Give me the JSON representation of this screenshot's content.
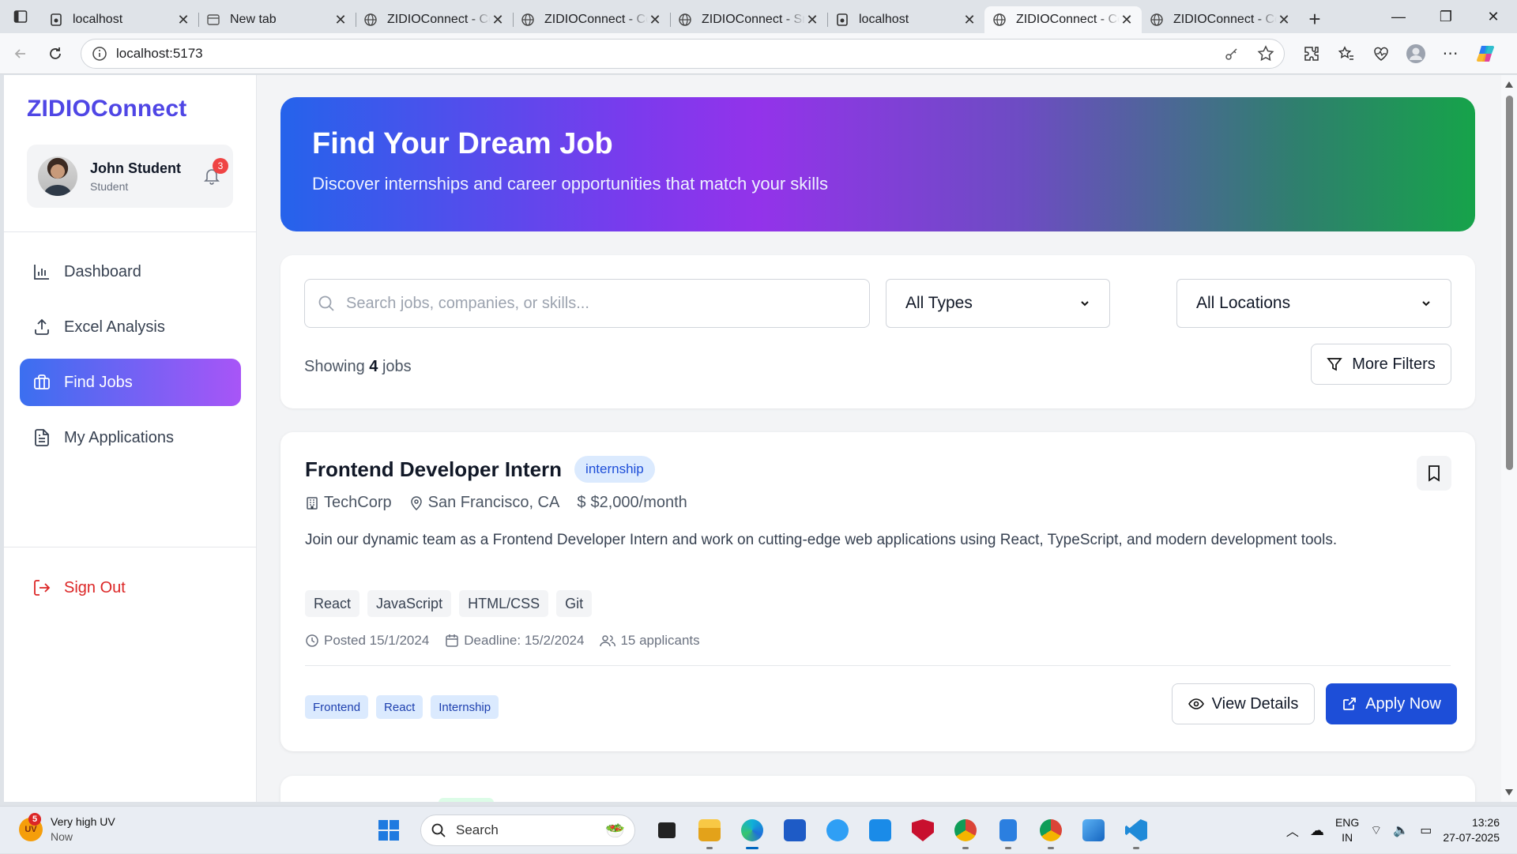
{
  "browser": {
    "tabs": [
      {
        "title": "localhost",
        "favicon": "page-icon",
        "active": false
      },
      {
        "title": "New tab",
        "favicon": "newtab-icon",
        "active": false
      },
      {
        "title": "ZIDIOConnect - Cc",
        "favicon": "globe-icon",
        "active": false
      },
      {
        "title": "ZIDIOConnect - Cc",
        "favicon": "globe-icon",
        "active": false
      },
      {
        "title": "ZIDIOConnect - Sr",
        "favicon": "globe-icon",
        "active": false
      },
      {
        "title": "localhost",
        "favicon": "page-icon",
        "active": false
      },
      {
        "title": "ZIDIOConnect - Cc",
        "favicon": "globe-icon",
        "active": true
      },
      {
        "title": "ZIDIOConnect - Cc",
        "favicon": "globe-icon",
        "active": false
      }
    ],
    "address": "localhost:5173"
  },
  "sidebar": {
    "brand": "ZIDIOConnect",
    "user": {
      "name": "John Student",
      "role": "Student",
      "notifications": "3"
    },
    "menu": [
      {
        "label": "Dashboard",
        "icon": "bar-chart-icon",
        "active": false
      },
      {
        "label": "Excel Analysis",
        "icon": "upload-icon",
        "active": false
      },
      {
        "label": "Find Jobs",
        "icon": "briefcase-icon",
        "active": true
      },
      {
        "label": "My Applications",
        "icon": "document-icon",
        "active": false
      }
    ],
    "sign_out": "Sign Out"
  },
  "hero": {
    "title": "Find Your Dream Job",
    "subtitle": "Discover internships and career opportunities that match your skills"
  },
  "filters": {
    "search_placeholder": "Search jobs, companies, or skills...",
    "type_selected": "All Types",
    "location_selected": "All Locations",
    "showing_prefix": "Showing",
    "showing_count": "4",
    "showing_suffix": "jobs",
    "more_filters": "More Filters"
  },
  "jobs": [
    {
      "title": "Frontend Developer Intern",
      "type": "internship",
      "company": "TechCorp",
      "location": "San Francisco, CA",
      "salary": "$2,000/month",
      "description": "Join our dynamic team as a Frontend Developer Intern and work on cutting-edge web applications using React, TypeScript, and modern development tools.",
      "skills": [
        "React",
        "JavaScript",
        "HTML/CSS",
        "Git"
      ],
      "posted": "Posted 15/1/2024",
      "deadline": "Deadline: 15/2/2024",
      "applicants": "15 applicants",
      "tags": [
        "Frontend",
        "React",
        "Internship"
      ],
      "view_label": "View Details",
      "apply_label": "Apply Now"
    }
  ],
  "colors": {
    "brand": "#4f46e5",
    "primary_button": "#1d4ed8",
    "danger": "#dc2626"
  },
  "taskbar": {
    "weather_title": "Very high UV",
    "weather_sub": "Now",
    "weather_badge": "5",
    "search_label": "Search",
    "lang_top": "ENG",
    "lang_bottom": "IN",
    "time": "13:26",
    "date": "27-07-2025"
  }
}
